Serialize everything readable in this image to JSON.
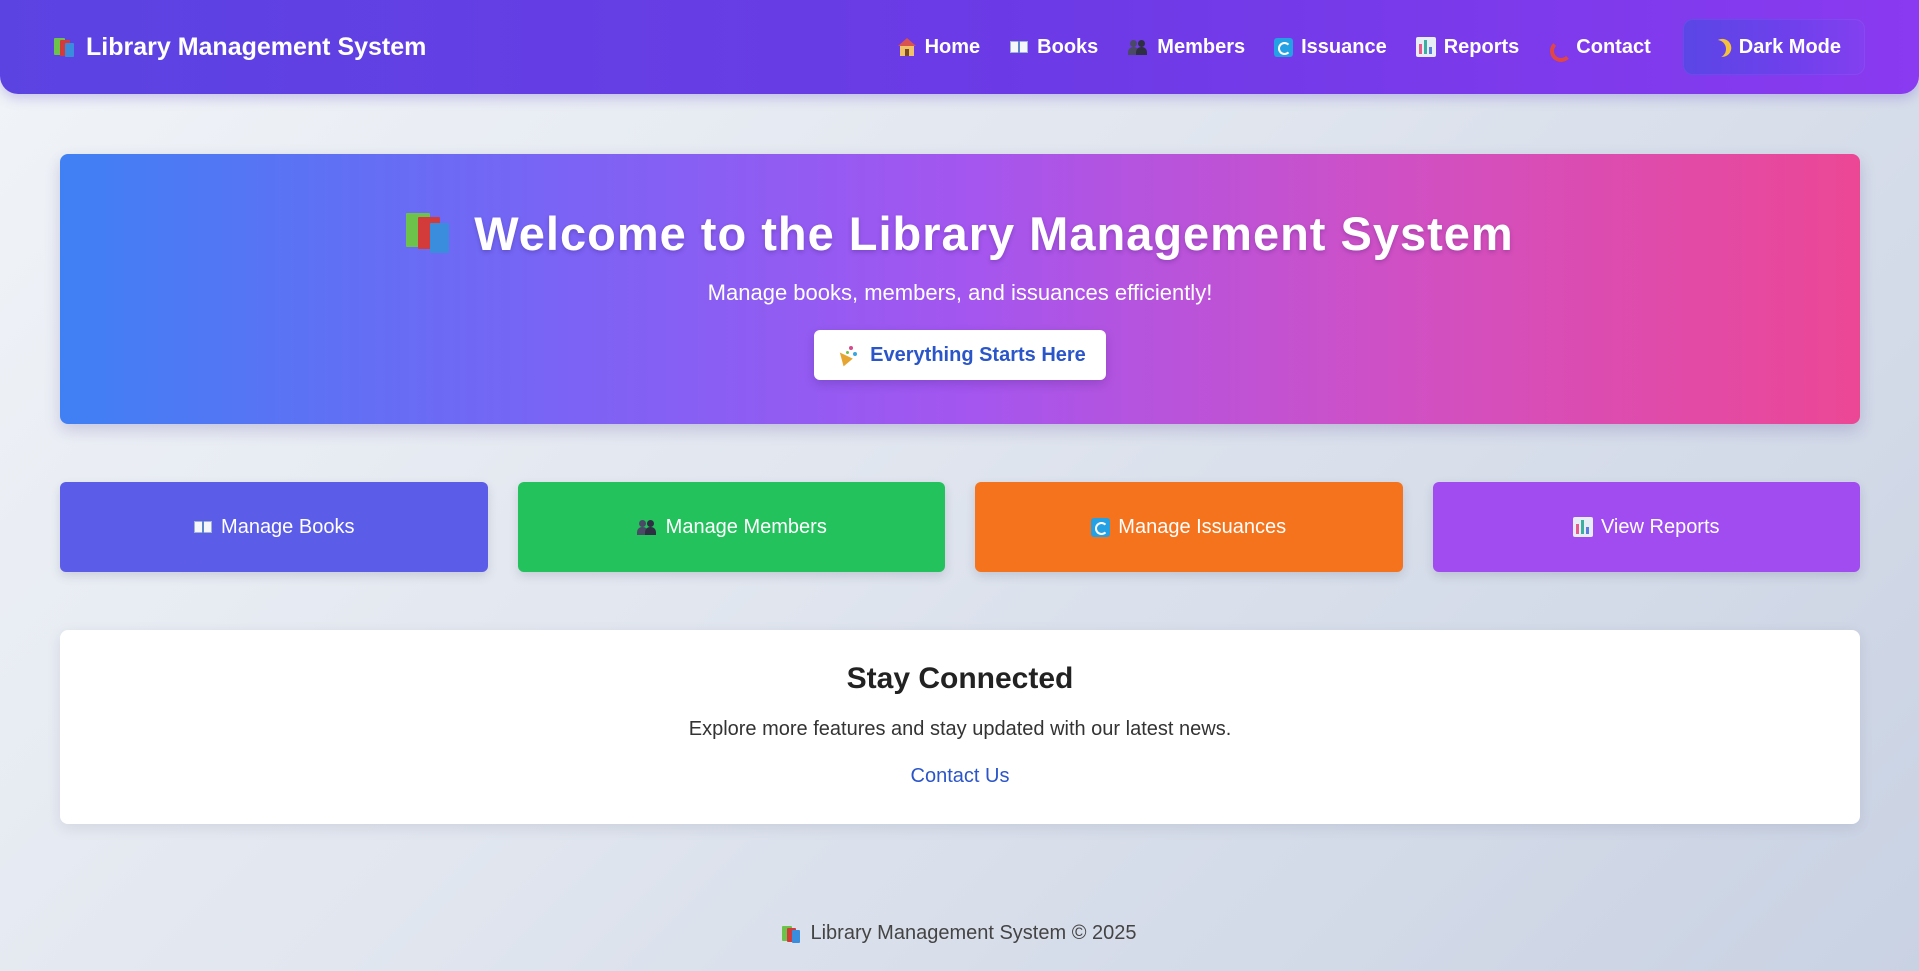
{
  "navbar": {
    "brand_icon": "books-icon",
    "brand": "Library Management System",
    "links": [
      {
        "icon": "house-icon",
        "label": "Home"
      },
      {
        "icon": "open-book-icon",
        "label": "Books"
      },
      {
        "icon": "people-icon",
        "label": "Members"
      },
      {
        "icon": "cycle-icon",
        "label": "Issuance"
      },
      {
        "icon": "bar-chart-icon",
        "label": "Reports"
      },
      {
        "icon": "phone-icon",
        "label": "Contact"
      }
    ],
    "dark_mode": {
      "icon": "moon-icon",
      "label": "Dark Mode"
    }
  },
  "hero": {
    "title_icon": "books-icon",
    "title": "Welcome to the Library Management System",
    "subtitle": "Manage books, members, and issuances efficiently!",
    "button": {
      "icon": "party-popper-icon",
      "label": "Everything Starts Here"
    }
  },
  "cards": [
    {
      "icon": "open-book-icon",
      "label": "Manage Books",
      "color": "#5b5ce8"
    },
    {
      "icon": "people-icon",
      "label": "Manage Members",
      "color": "#23c25d"
    },
    {
      "icon": "cycle-icon",
      "label": "Manage Issuances",
      "color": "#f5731c"
    },
    {
      "icon": "bar-chart-icon",
      "label": "View Reports",
      "color": "#a04cf0"
    }
  ],
  "connect": {
    "title": "Stay Connected",
    "text": "Explore more features and stay updated with our latest news.",
    "link": "Contact Us"
  },
  "footer": {
    "icon": "books-icon",
    "text": "Library Management System © 2025"
  },
  "colors": {
    "nav_gradient": [
      "#5b43e2",
      "#8a3af0"
    ],
    "hero_gradient": [
      "#3f80f4",
      "#a356f0",
      "#ec4795"
    ],
    "link": "#2b56c9"
  }
}
